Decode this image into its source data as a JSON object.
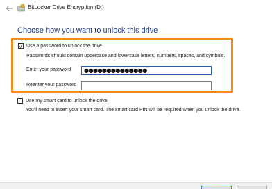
{
  "window": {
    "title": "BitLocker Drive Encryption (D:)"
  },
  "icons": {
    "back": "back-arrow-icon",
    "app": "bitlocker-drive-icon"
  },
  "heading": "Choose how you want to unlock this drive",
  "password_option": {
    "checked": true,
    "label": "Use a password to unlock the drive",
    "note": "Passwords should contain uppercase and lowercase letters, numbers, spaces, and symbols.",
    "enter_label": "Enter your password",
    "enter_value": "●●●●●●●●●●●●●●",
    "reenter_label": "Reenter your password",
    "reenter_value": ""
  },
  "smartcard_option": {
    "checked": false,
    "label": "Use my smart card to unlock the drive",
    "note": "You'll need to insert your smart card. The smart card PIN will be required when you unlock the drive."
  },
  "colors": {
    "heading": "#1f3d8c",
    "highlight_border": "#f28a1e",
    "focus_border": "#2b5fb4"
  }
}
